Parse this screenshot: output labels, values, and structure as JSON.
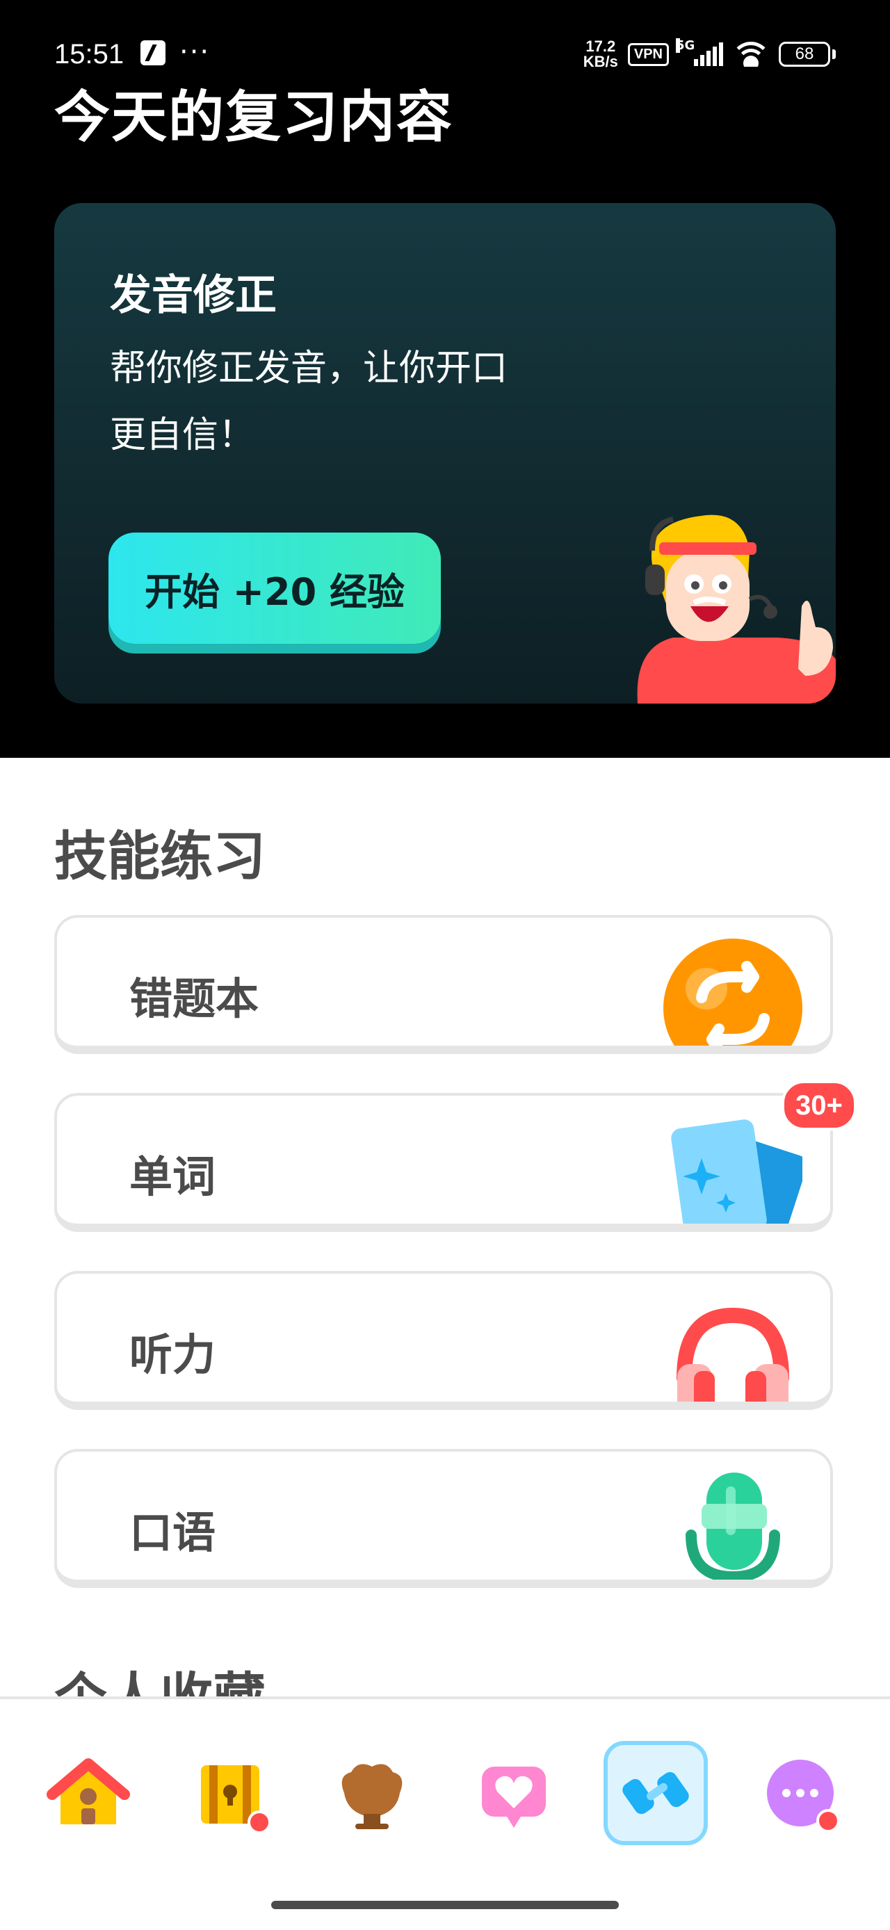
{
  "status_bar": {
    "time": "15:51",
    "net_speed_value": "17.2",
    "net_speed_unit": "KB/s",
    "vpn": "VPN",
    "network": "5G",
    "battery": "68"
  },
  "page": {
    "title": "今天的复习内容"
  },
  "hero": {
    "title": "发音修正",
    "description": "帮你修正发音，让你开口更自信！",
    "button_label": "开始 +20 经验"
  },
  "skills": {
    "title": "技能练习",
    "items": [
      {
        "label": "错题本",
        "icon": "refresh-circle-icon"
      },
      {
        "label": "单词",
        "icon": "cards-icon",
        "badge": "30+"
      },
      {
        "label": "听力",
        "icon": "headphones-icon"
      },
      {
        "label": "口语",
        "icon": "microphone-icon"
      }
    ]
  },
  "next_section": {
    "title": "个人收藏"
  },
  "tabbar": {
    "items": [
      {
        "icon": "home-icon"
      },
      {
        "icon": "treasure-chest-icon"
      },
      {
        "icon": "shield-icon"
      },
      {
        "icon": "heart-icon"
      },
      {
        "icon": "dumbbell-icon"
      },
      {
        "icon": "more-icon"
      }
    ]
  },
  "colors": {
    "accent_teal": "#2de6ee",
    "badge_red": "#ff4b4b",
    "orange": "#ff9600",
    "blue": "#1cb0f6"
  }
}
